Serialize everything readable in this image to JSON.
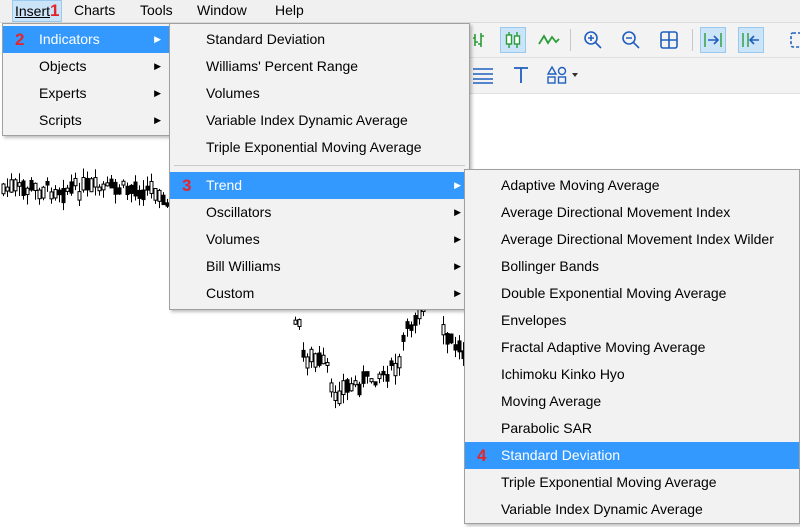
{
  "menubar": {
    "items": [
      {
        "label": "Insert",
        "badge": "1"
      },
      {
        "label": "Charts"
      },
      {
        "label": "Tools"
      },
      {
        "label": "Window"
      },
      {
        "label": "Help"
      }
    ]
  },
  "insert_menu": {
    "items": [
      {
        "label": "Indicators",
        "badge": "2"
      },
      {
        "label": "Objects"
      },
      {
        "label": "Experts"
      },
      {
        "label": "Scripts"
      }
    ]
  },
  "indicators_menu": {
    "recent": [
      "Standard Deviation",
      "Williams' Percent Range",
      "Volumes",
      "Variable Index Dynamic Average",
      "Triple Exponential Moving Average"
    ],
    "groups": [
      {
        "label": "Trend",
        "badge": "3"
      },
      {
        "label": "Oscillators"
      },
      {
        "label": "Volumes"
      },
      {
        "label": "Bill Williams"
      },
      {
        "label": "Custom"
      }
    ]
  },
  "trend_menu": {
    "items": [
      "Adaptive Moving Average",
      "Average Directional Movement Index",
      "Average Directional Movement Index Wilder",
      "Bollinger Bands",
      "Double Exponential Moving Average",
      "Envelopes",
      "Fractal Adaptive Moving Average",
      "Ichimoku Kinko Hyo",
      "Moving Average",
      "Parabolic SAR",
      "Standard Deviation",
      "Triple Exponential Moving Average",
      "Variable Index Dynamic Average"
    ],
    "selected_badge": "4"
  },
  "toolbar": {
    "icons": [
      "line-chart-icon",
      "candlestick-icon",
      "line-icon",
      "zoom-in-icon",
      "zoom-out-icon",
      "grid-icon",
      "autoscroll-icon",
      "chart-shift-icon",
      "horizontal-lines-icon",
      "text-icon",
      "shapes-icon"
    ]
  },
  "colors": {
    "accent": "#3399ff",
    "badge": "#e3262b",
    "toolbar_on": "#cce4f7"
  }
}
